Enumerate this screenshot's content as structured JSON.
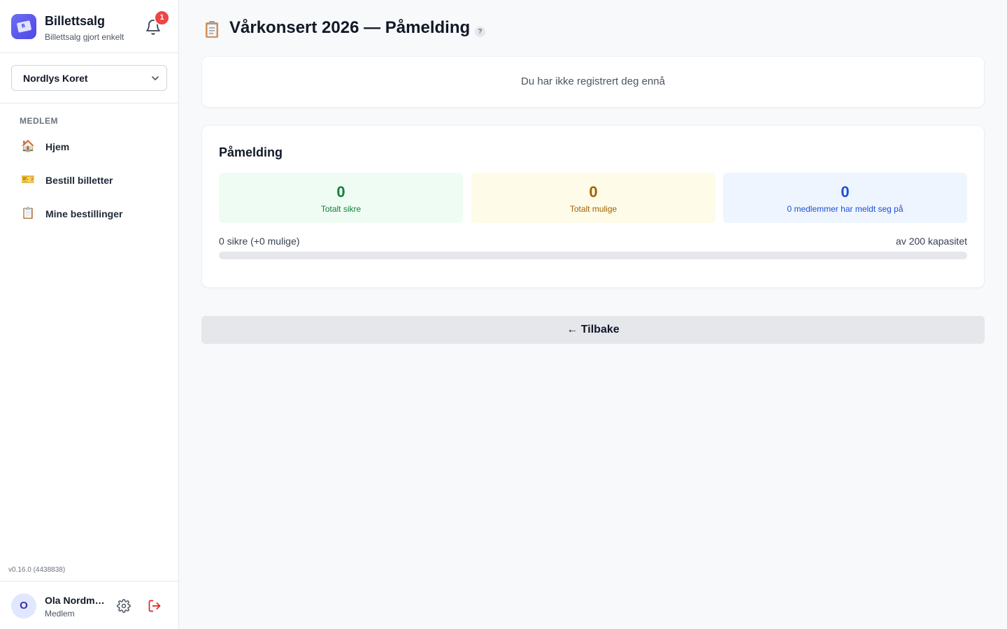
{
  "app": {
    "title": "Billettsalg",
    "subtitle": "Billettsalg gjort enkelt",
    "logo_letter": "B",
    "notification_count": "1"
  },
  "org_select": {
    "selected": "Nordlys Koret"
  },
  "nav": {
    "section_label": "MEDLEM",
    "items": [
      {
        "label": "Hjem",
        "icon": "house-icon",
        "glyph": "🏠"
      },
      {
        "label": "Bestill billetter",
        "icon": "ticket-icon",
        "glyph": "🎫"
      },
      {
        "label": "Mine bestillinger",
        "icon": "clipboard-icon",
        "glyph": "📋"
      }
    ]
  },
  "version": "v0.16.0 (4438838)",
  "user": {
    "initial": "O",
    "name": "Ola Nordmann",
    "role": "Medlem"
  },
  "page": {
    "title": "Vårkonsert 2026 — Påmelding",
    "help": "?",
    "notice": "Du har ikke registrert deg ennå"
  },
  "registration": {
    "heading": "Påmelding",
    "stats": [
      {
        "value": "0",
        "caption": "Totalt sikre"
      },
      {
        "value": "0",
        "caption": "Totalt mulige"
      },
      {
        "value": "0",
        "caption": "0 medlemmer har meldt seg på"
      }
    ],
    "progress_left": "0 sikre (+0 mulige)",
    "progress_right": "av 200 kapasitet",
    "progress_fraction": 0
  },
  "back_button": "← Tilbake",
  "colors": {
    "accent": "#4f46e5",
    "danger": "#ef4444",
    "green": "#15803d",
    "yellow": "#a16207",
    "blue": "#1d4ed8"
  }
}
